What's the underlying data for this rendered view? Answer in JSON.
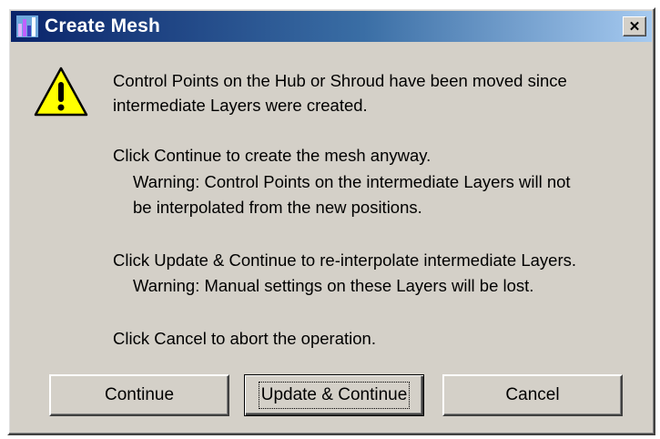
{
  "window": {
    "title": "Create Mesh",
    "close_symbol": "✕"
  },
  "message": {
    "line1": "Control Points on the Hub or Shroud have been moved since",
    "line2": "intermediate Layers were created.",
    "line3": "Click Continue to create the mesh anyway.",
    "line4": "Warning: Control Points on the intermediate Layers will not",
    "line5": "be interpolated from the new positions.",
    "line6": "Click Update & Continue to re-interpolate intermediate Layers.",
    "line7": "Warning: Manual settings on these Layers will be lost.",
    "line8": "Click Cancel to abort the operation."
  },
  "buttons": {
    "continue": "Continue",
    "update_continue": "Update & Continue",
    "cancel": "Cancel"
  },
  "icons": {
    "app": "app-icon",
    "warning": "warning-icon",
    "close": "close-icon"
  },
  "colors": {
    "title_start": "#0a246a",
    "title_end": "#a6caf0",
    "dialog_bg": "#d4d0c8",
    "warning_yellow": "#ffff00"
  }
}
